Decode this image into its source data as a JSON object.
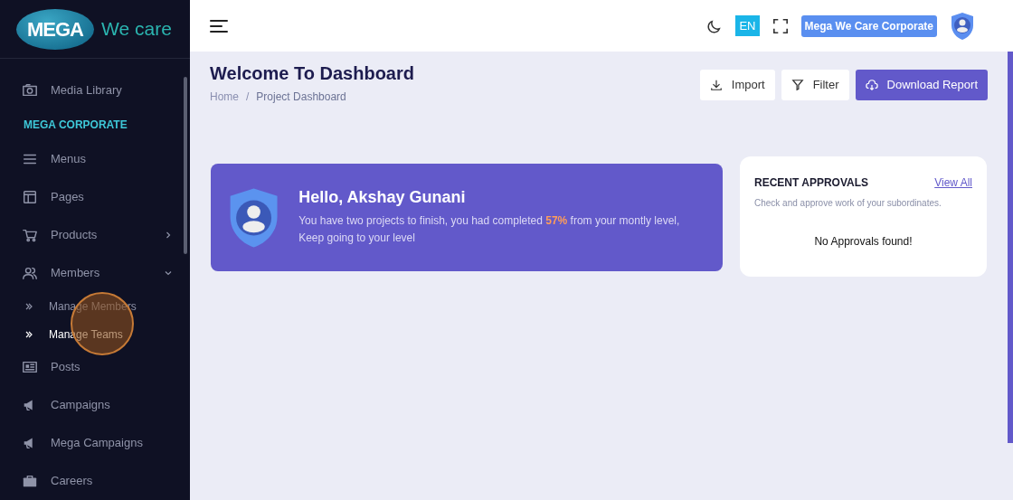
{
  "logo": {
    "badge": "MEGA",
    "text": "We care"
  },
  "sidebar": {
    "items": [
      {
        "kind": "item",
        "label": "Media Library"
      },
      {
        "kind": "section",
        "label": "MEGA CORPORATE"
      },
      {
        "kind": "item",
        "label": "Menus"
      },
      {
        "kind": "item",
        "label": "Pages"
      },
      {
        "kind": "item",
        "label": "Products",
        "expanded": false
      },
      {
        "kind": "item",
        "label": "Members",
        "expanded": true,
        "children": [
          {
            "label": "Manage Members",
            "selected": false
          },
          {
            "label": "Manage Teams",
            "selected": true
          }
        ]
      },
      {
        "kind": "item",
        "label": "Posts"
      },
      {
        "kind": "item",
        "label": "Campaigns"
      },
      {
        "kind": "item",
        "label": "Mega Campaigns"
      },
      {
        "kind": "item",
        "label": "Careers"
      }
    ]
  },
  "topbar": {
    "language": "EN",
    "company": "Mega We Care Corporate"
  },
  "page": {
    "title": "Welcome To Dashboard",
    "breadcrumb": [
      "Home",
      "Project Dashboard"
    ],
    "breadcrumb_separator": "/",
    "actions": [
      {
        "label": "Import",
        "kind": "light"
      },
      {
        "label": "Filter",
        "kind": "light"
      },
      {
        "label": "Download Report",
        "kind": "primary"
      }
    ]
  },
  "welcome": {
    "title": "Hello, Akshay Gunani",
    "text": "You have two projects to finish, you had completed **57%** from your montly level, Keep going to your level"
  },
  "approvals": {
    "title": "RECENT APPROVALS",
    "link": "View All",
    "subtitle": "Check and approve work of your subordinates.",
    "empty": "No Approvals found!"
  }
}
